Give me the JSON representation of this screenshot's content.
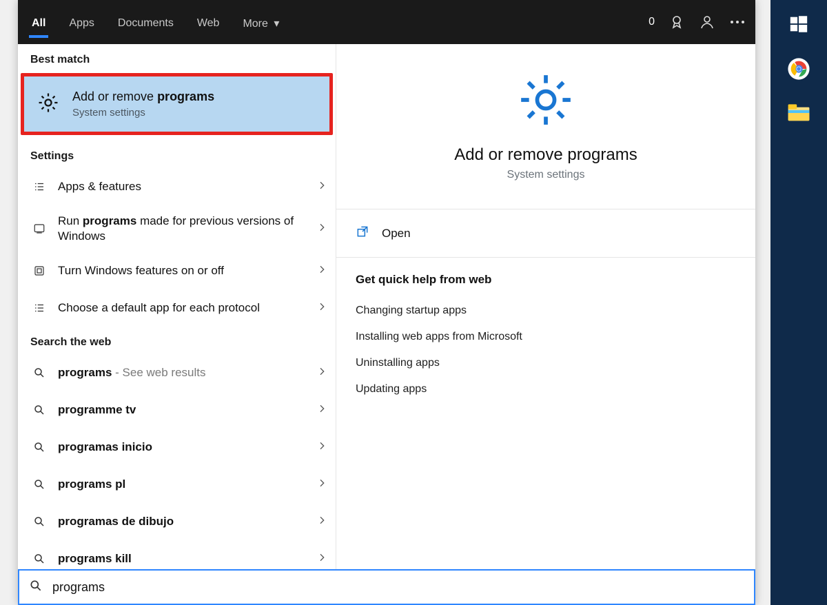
{
  "header": {
    "tabs": [
      "All",
      "Apps",
      "Documents",
      "Web",
      "More"
    ],
    "active_tab_index": 0,
    "reward_count": "0"
  },
  "left": {
    "best_match_label": "Best match",
    "best_match": {
      "title_prefix": "Add or remove ",
      "title_bold": "programs",
      "subtitle": "System settings"
    },
    "settings_label": "Settings",
    "settings": [
      {
        "label_plain": "Apps & features",
        "label_bold": "",
        "label_suffix": ""
      },
      {
        "label_plain": "Run ",
        "label_bold": "programs",
        "label_suffix": " made for previous versions of Windows"
      },
      {
        "label_plain": "Turn Windows features on or off",
        "label_bold": "",
        "label_suffix": ""
      },
      {
        "label_plain": "Choose a default app for each protocol",
        "label_bold": "",
        "label_suffix": ""
      }
    ],
    "web_label": "Search the web",
    "web_results": [
      {
        "label_bold": "programs",
        "hint": " - See web results"
      },
      {
        "label_bold": "programme tv",
        "hint": ""
      },
      {
        "label_bold": "programas inicio",
        "hint": ""
      },
      {
        "label_bold": "programs pl",
        "hint": ""
      },
      {
        "label_bold": "programas de dibujo",
        "hint": ""
      },
      {
        "label_bold": "programs kill",
        "hint": ""
      }
    ]
  },
  "right": {
    "title": "Add or remove programs",
    "subtitle": "System settings",
    "open_label": "Open",
    "help_title": "Get quick help from web",
    "help_links": [
      "Changing startup apps",
      "Installing web apps from Microsoft",
      "Uninstalling apps",
      "Updating apps"
    ]
  },
  "search": {
    "query": "programs"
  }
}
